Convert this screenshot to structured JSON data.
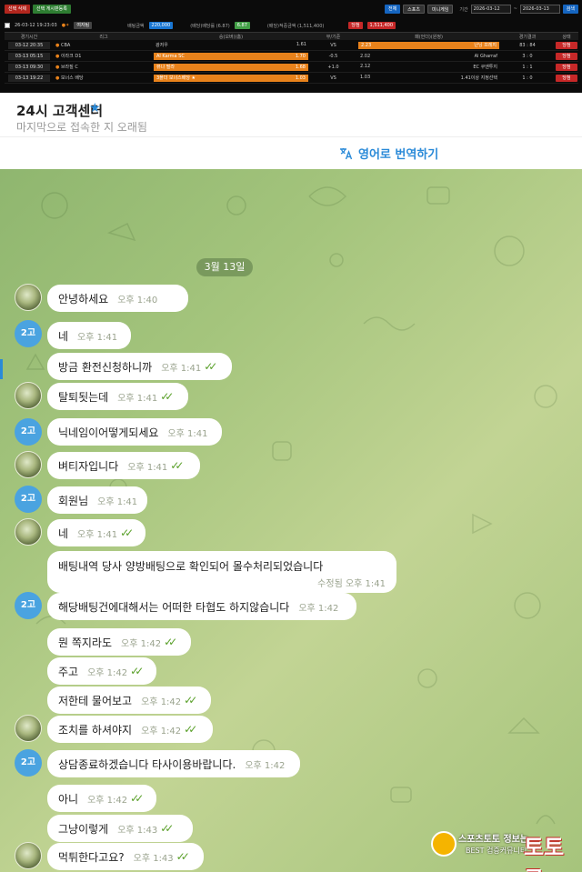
{
  "betting": {
    "top_buttons": [
      "선택 삭제",
      "선택 게시판등록"
    ],
    "right_controls": {
      "buttons": [
        "전체",
        "스포츠",
        "미니게임"
      ],
      "period_label": "기간",
      "date_from": "2026-03-12",
      "date_to": "2026-03-13",
      "search": "검색"
    },
    "info": {
      "datetime": "26-03-12 19:23:03",
      "badge": "여자팀",
      "amount_label": "배팅금액",
      "amount": "220,000",
      "odds_label": "(배당)배당률 (6.87)",
      "odds_value": "6.87",
      "winnings_label": "(배당)적중금액 (1,511,400)",
      "status": "당첨",
      "winnings": "1,511,400"
    },
    "headers": [
      "경기시간",
      "리그",
      "승(오버)(홈)",
      "무/기준",
      "패(언더)(원정)",
      "경기결과",
      "상태"
    ],
    "right_header": "삭제",
    "rows": [
      {
        "time": "03-12 20:35",
        "league": "CBA",
        "home": "광저우",
        "home_odds": "1.61",
        "draw": "VS",
        "away_odds": "2.23",
        "away": "난닝 프레지",
        "result": "83 : 84",
        "status": "당첨"
      },
      {
        "time": "03-13 05:15",
        "league": "이라크 D1",
        "home": "Al Karma SC",
        "home_odds": "1.70",
        "draw": "-0.5",
        "away_odds": "2.02",
        "away": "Al Gharraf",
        "result": "3 : 0",
        "status": "당첨"
      },
      {
        "time": "03-13 09:30",
        "league": "브라질 C",
        "home": "뷰나 필라",
        "home_odds": "1.68",
        "draw": "+1.0",
        "away_odds": "2.12",
        "away": "EC 쿠엔투지",
        "result": "1 : 1",
        "status": "당첨"
      },
      {
        "time": "03-13 19:22",
        "league": "보너스 배당",
        "home": "3폴더 보너스배당 ★",
        "home_odds": "1.03",
        "draw": "VS",
        "away_odds": "1.03",
        "away": "1.41이상 지정선택",
        "result": "1 : 0",
        "status": "당첨"
      }
    ]
  },
  "header": {
    "title": "24시 고객센터",
    "subtitle": "마지막으로 접속한 지 오래됨"
  },
  "translate": {
    "label": "영어로 번역하기"
  },
  "chat": {
    "date_separator": "3월 13일",
    "messages": [
      {
        "text": "안녕하세요",
        "time": "오후 1:40",
        "check": false
      },
      {
        "text": "네",
        "time": "오후 1:41",
        "check": false
      },
      {
        "text": "방금 환전신청하니까",
        "time": "오후 1:41",
        "check": true
      },
      {
        "text": "탈퇴됫는데",
        "time": "오후 1:41",
        "check": true
      },
      {
        "text": "닉네임이어떻게되세요",
        "time": "오후 1:41",
        "check": false
      },
      {
        "text": "벼티자입니다",
        "time": "오후 1:41",
        "check": true
      },
      {
        "text": "회원님",
        "time": "오후 1:41",
        "check": false
      },
      {
        "text": "네",
        "time": "오후 1:41",
        "check": true
      },
      {
        "text": "배팅내역 당사 양방배팅으로 확인되어 몰수처리되었습니다",
        "time": "수정됨 오후 1:41",
        "check": false
      },
      {
        "text": "해당배팅건에대해서는 어떠한 타협도 하지않습니다",
        "time": "오후 1:42",
        "check": false
      },
      {
        "text": "뭔 쪽지라도",
        "time": "오후 1:42",
        "check": true
      },
      {
        "text": "주고",
        "time": "오후 1:42",
        "check": true
      },
      {
        "text": "저한테 물어보고",
        "time": "오후 1:42",
        "check": true
      },
      {
        "text": "조치를 하셔야지",
        "time": "오후 1:42",
        "check": true
      },
      {
        "text": "상담종료하겠습니다 타사이용바랍니다.",
        "time": "오후 1:42",
        "check": false
      },
      {
        "text": "아니",
        "time": "오후 1:42",
        "check": true
      },
      {
        "text": "그냥이렇게",
        "time": "오후 1:43",
        "check": true
      },
      {
        "text": "먹튀한다고요?",
        "time": "오후 1:43",
        "check": true
      }
    ],
    "agent_avatar": "2고"
  },
  "watermark": {
    "line1": "스포츠토토 정보는",
    "line2": "BEST 검증커뮤니티",
    "brand": "토토군"
  },
  "colors": {
    "accent": "#2a8ad8",
    "check": "#5aa02a",
    "orange": "#e8821b",
    "red": "#c62828"
  }
}
